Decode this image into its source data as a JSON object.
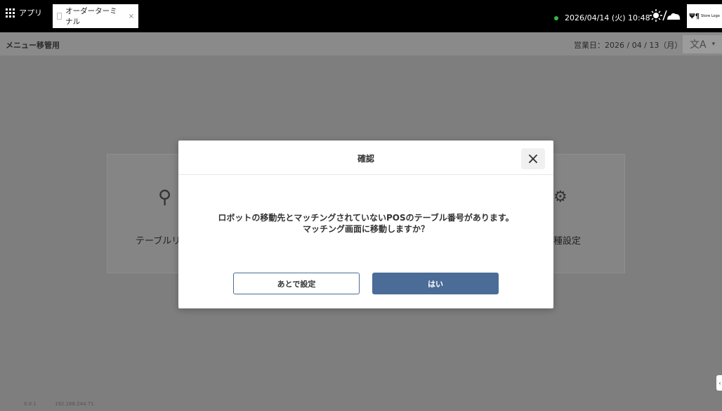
{
  "topbar": {
    "apps_label": "アプリ",
    "tab_title": "オーダーターミナル",
    "tab_close": "×",
    "datetime": "2026/04/14 (火) 10:48",
    "store_logo_text": "Store Logo",
    "store_logo_glyph": "Ψ¶"
  },
  "header": {
    "title": "メニュー移管用",
    "business_date": "営業日：2026 / 04 / 13（月）",
    "lang_glyph": "文A",
    "lang_chevron": "▾"
  },
  "menu": {
    "left_icon": "table-icon",
    "left_label": "テーブルリ",
    "right_icon": "gear-icon",
    "right_label": "種設定"
  },
  "footer": {
    "version": "0.0.1",
    "ip": "192.168.244.71"
  },
  "dialog": {
    "title": "確認",
    "close_glyph": "×",
    "message_line1": "ロボットの移動先とマッチングされていないPOSのテーブル番号があります。",
    "message_line2": "マッチング画面に移動しますか？",
    "later_label": "あとで設定",
    "yes_label": "はい"
  },
  "colors": {
    "primary": "#4a6c97",
    "status_online": "#3bb54a",
    "overlay": "#7e7e7e"
  }
}
